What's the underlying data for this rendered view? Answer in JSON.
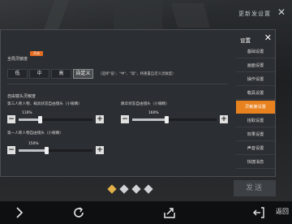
{
  "top_bar": {
    "link_text": "更新发设置",
    "close_glyph": "✕"
  },
  "dialog": {
    "overall_section_title": "全局灵敏度",
    "overall_badge": "开启",
    "sensitivity_options": [
      {
        "label": "低",
        "active": false
      },
      {
        "label": "中",
        "active": false
      },
      {
        "label": "高",
        "active": false
      },
      {
        "label": "自定义",
        "active": true
      }
    ],
    "custom_hint": "（选择\"低\"、\"中\"、\"高\"，将重置自定义灵敏度）",
    "gyro_section_title": "自由镜头灵敏度",
    "sliders": [
      {
        "label": "第三人称人物、载具状态自由镜头（小眼睛）",
        "value_text": "116%",
        "value": 116
      },
      {
        "label": "跳伞状态自由镜头（小眼睛）",
        "value_text": "160%",
        "value": 160
      },
      {
        "label": "第一人称人物自由镜头（小眼睛）",
        "value_text": "150%",
        "value": 150
      }
    ],
    "slider_max": 400,
    "minus_glyph": "−",
    "plus_glyph": "+"
  },
  "side_menu": {
    "title": "设置",
    "close_glyph": "✕",
    "items": [
      {
        "label": "基础设置",
        "active": false
      },
      {
        "label": "画面设置",
        "active": false
      },
      {
        "label": "操作设置",
        "active": false
      },
      {
        "label": "载具设置",
        "active": false
      },
      {
        "label": "灵敏度设置",
        "active": true
      },
      {
        "label": "拾取设置",
        "active": false
      },
      {
        "label": "效果设置",
        "active": false
      },
      {
        "label": "声音设置",
        "active": false
      },
      {
        "label": "快捷消息",
        "active": false
      }
    ]
  },
  "carousel": {
    "count": 4,
    "active_index": 0
  },
  "chat": {
    "send_label": "发送"
  },
  "system_bar": {
    "back_label": "返回",
    "icons": [
      "forward-icon",
      "refresh-icon",
      "share-icon",
      "back-icon"
    ]
  },
  "colors": {
    "accent": "#e8821f",
    "dialog_bg": "#2c2f33"
  }
}
